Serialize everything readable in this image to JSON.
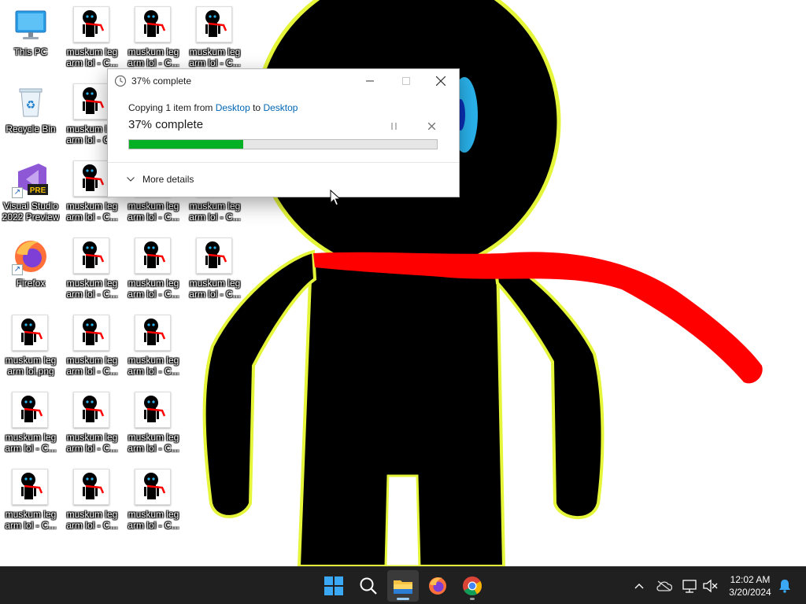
{
  "desktop": {
    "icons": [
      {
        "label": "This PC",
        "type": "computer"
      },
      {
        "label": "Recycle Bin",
        "type": "recycle"
      },
      {
        "label": "Visual Studio 2022 Preview",
        "type": "vs",
        "badge": "PRE"
      },
      {
        "label": "Firefox",
        "type": "firefox"
      },
      {
        "label": "muskum leg arm lol.png",
        "type": "thumb"
      },
      {
        "label": "muskum leg arm lol - C...",
        "type": "thumb"
      }
    ]
  },
  "dialog": {
    "title": "37% complete",
    "copy_prefix": "Copying 1 item from ",
    "source": "Desktop",
    "copy_mid": " to ",
    "destination": "Desktop",
    "status": "37% complete",
    "progress": 0.37,
    "more_details": "More details",
    "progress_color": "#06b025"
  },
  "taskbar": {
    "apps": [
      "start-icon",
      "search-icon",
      "file-explorer-icon",
      "firefox-icon",
      "chrome-icon"
    ],
    "clock": {
      "time": "12:02 AM",
      "date": "3/20/2024"
    }
  }
}
